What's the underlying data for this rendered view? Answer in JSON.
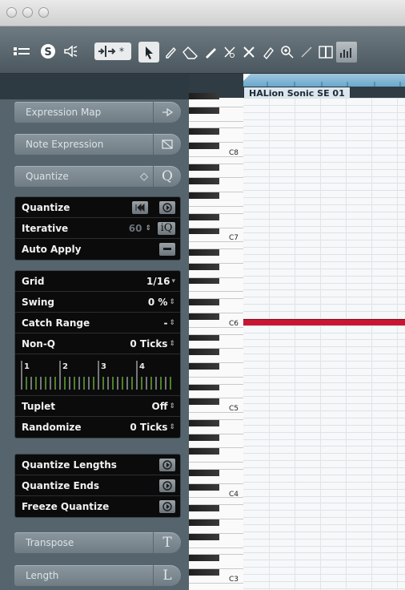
{
  "window": {
    "title": ""
  },
  "toolbar": {
    "icons": [
      "inspector-toggle-icon",
      "solo-icon",
      "listen-icon",
      "autoscroll-icon",
      "object-select-icon",
      "draw-icon",
      "erase-icon",
      "trim-icon",
      "split-icon",
      "mute-icon",
      "glue-icon",
      "zoom-icon",
      "line-icon",
      "time-warp-icon",
      "meter-icon"
    ]
  },
  "part_label": "HALion Sonic SE 01",
  "inspector": {
    "expression_map": "Expression Map",
    "note_expression": "Note Expression",
    "quantize_section": "Quantize",
    "quantize_section_icon": "Q",
    "quantize_box": {
      "quantize": "Quantize",
      "iterative": "Iterative",
      "iterative_value": "60",
      "iterative_icon": "iQ",
      "auto_apply": "Auto Apply"
    },
    "grid_box": {
      "grid": "Grid",
      "grid_value": "1/16",
      "swing": "Swing",
      "swing_value": "0 %",
      "catch_range": "Catch Range",
      "catch_range_value": "-",
      "non_q": "Non-Q",
      "non_q_value": "0 Ticks",
      "grid_markers": [
        "1",
        "2",
        "3",
        "4"
      ],
      "tuplet": "Tuplet",
      "tuplet_value": "Off",
      "randomize": "Randomize",
      "randomize_value": "0 Ticks"
    },
    "actions_box": {
      "quantize_lengths": "Quantize Lengths",
      "quantize_ends": "Quantize Ends",
      "freeze_quantize": "Freeze Quantize"
    },
    "transpose": "Transpose",
    "transpose_icon": "T",
    "length": "Length",
    "length_icon": "L"
  },
  "keyboard": {
    "labels": [
      "C8",
      "C7",
      "C6",
      "C5",
      "C4",
      "C3"
    ]
  },
  "colors": {
    "note": "#c81632",
    "inspector_bg": "#55646d",
    "toolbar_bg": "#5a666d"
  }
}
